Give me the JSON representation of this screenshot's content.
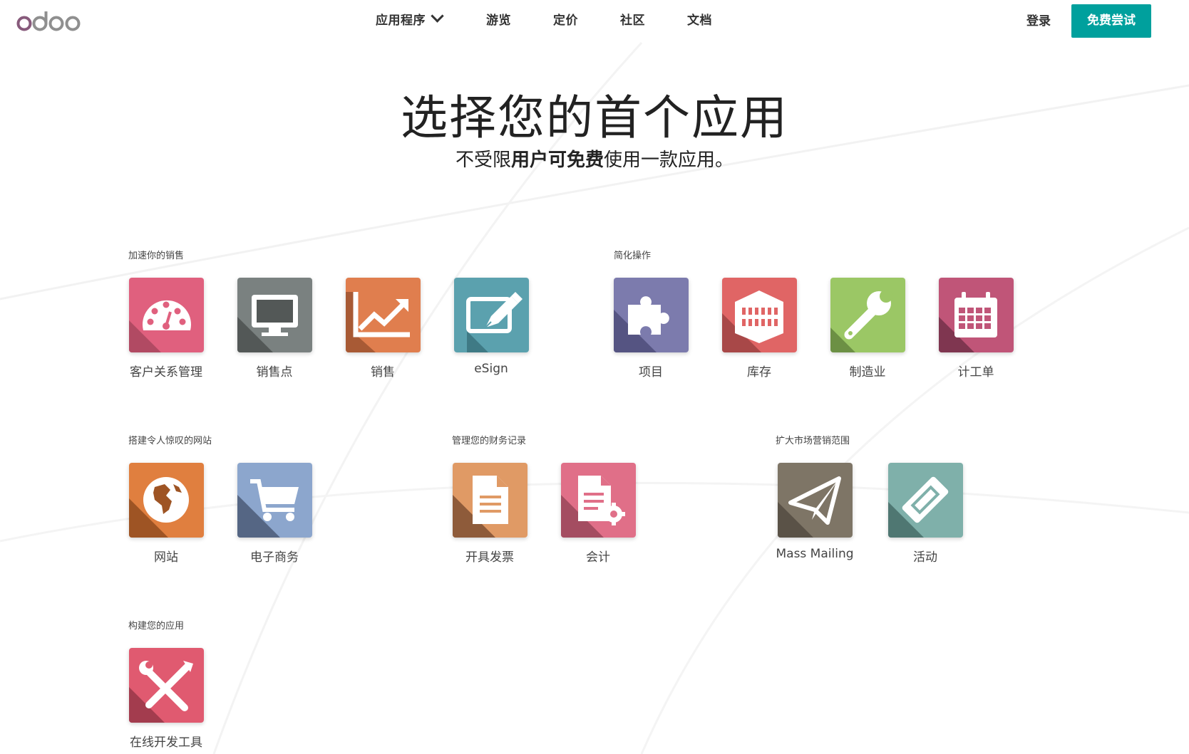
{
  "header": {
    "logo_text": "odoo",
    "nav": [
      {
        "label": "应用程序",
        "has_dropdown": true
      },
      {
        "label": "游览"
      },
      {
        "label": "定价"
      },
      {
        "label": "社区"
      },
      {
        "label": "文档"
      }
    ],
    "login_label": "登录",
    "cta_label": "免费尝试",
    "cta_color": "#00A09D"
  },
  "hero": {
    "title": "选择您的首个应用",
    "subtitle_pre": "不受限",
    "subtitle_bold": "用户可免费",
    "subtitle_post": "使用一款应用。"
  },
  "sections": [
    {
      "label": "加速你的销售",
      "apps": [
        {
          "name": "客户关系管理",
          "icon": "gauge-icon",
          "color": "#E0607E"
        },
        {
          "name": "销售点",
          "icon": "monitor-icon",
          "color": "#7A8180"
        },
        {
          "name": "销售",
          "icon": "chart-line-icon",
          "color": "#E07E4E"
        },
        {
          "name": "eSign",
          "icon": "sign-pen-icon",
          "color": "#5BA1AE"
        }
      ]
    },
    {
      "label": "简化操作",
      "apps": [
        {
          "name": "项目",
          "icon": "puzzle-icon",
          "color": "#7C7BAD"
        },
        {
          "name": "库存",
          "icon": "warehouse-icon",
          "color": "#E06565"
        },
        {
          "name": "制造业",
          "icon": "wrench-icon",
          "color": "#9BC765"
        },
        {
          "name": "计工单",
          "icon": "calendar-icon",
          "color": "#C05578"
        }
      ]
    },
    {
      "label": "搭建令人惊叹的网站",
      "apps": [
        {
          "name": "网站",
          "icon": "globe-icon",
          "color": "#E07F3F"
        },
        {
          "name": "电子商务",
          "icon": "cart-icon",
          "color": "#8CA6CD"
        }
      ]
    },
    {
      "label": "管理您的财务记录",
      "apps": [
        {
          "name": "开具发票",
          "icon": "invoice-icon",
          "color": "#E09A65"
        },
        {
          "name": "会计",
          "icon": "accounting-icon",
          "color": "#E06F88"
        }
      ]
    },
    {
      "label": "扩大市场营销范围",
      "apps": [
        {
          "name": "Mass Mailing",
          "icon": "paper-plane-icon",
          "color": "#7E7566"
        },
        {
          "name": "活动",
          "icon": "ticket-icon",
          "color": "#7FB0AA"
        }
      ]
    },
    {
      "label": "构建您的应用",
      "apps": [
        {
          "name": "在线开发工具",
          "icon": "tools-icon",
          "color": "#E05A70"
        }
      ]
    }
  ]
}
